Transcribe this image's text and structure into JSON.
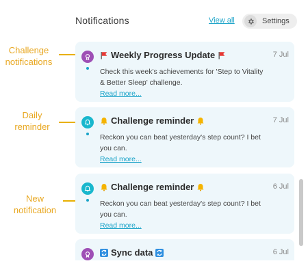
{
  "header": {
    "title": "Notifications",
    "view_all": "View all",
    "settings_label": "Settings"
  },
  "annotations": {
    "challenge": "Challenge\nnotifications",
    "daily": "Daily\nreminder",
    "new": "New\nnotification"
  },
  "notifications": [
    {
      "title": "Weekly Progress Update",
      "date": "7 Jul",
      "body": "Check this week's achievements for 'Step to Vitality & Better Sleep' challenge.",
      "read_more": "Read more...",
      "icon": "flag-icon",
      "avatar_color": "#9e4fb5"
    },
    {
      "title": "Challenge reminder",
      "date": "7 Jul",
      "body": "Reckon you can beat yesterday's step count? I bet you can.",
      "read_more": "Read more...",
      "icon": "bell-icon",
      "avatar_color": "#19b7cd"
    },
    {
      "title": "Challenge reminder",
      "date": "6 Jul",
      "body": "Reckon you can beat yesterday's step count? I bet you can.",
      "read_more": "Read more...",
      "icon": "bell-icon",
      "avatar_color": "#19b7cd"
    },
    {
      "title": "Sync data",
      "date": "6 Jul",
      "icon": "sync-icon",
      "avatar_color": "#9e4fb5"
    }
  ],
  "colors": {
    "accent": "#1aa3c8",
    "annotation": "#e8a720",
    "card_bg": "#eef7fb"
  }
}
